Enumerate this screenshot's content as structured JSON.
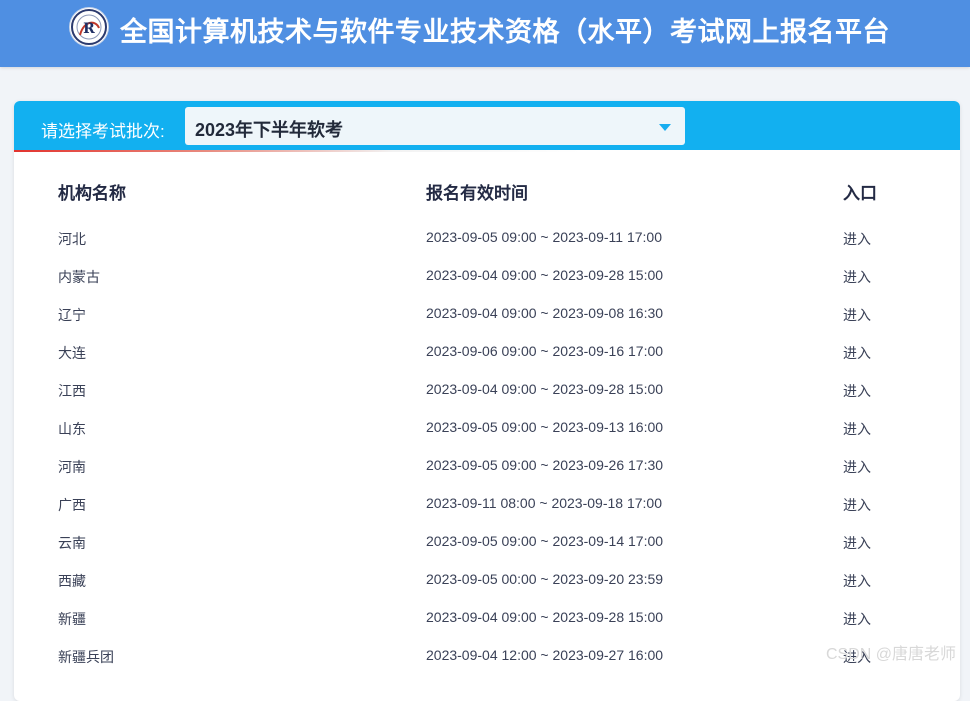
{
  "header": {
    "title": "全国计算机技术与软件专业技术资格（水平）考试网上报名平台",
    "logo_text": "R"
  },
  "selector": {
    "label": "请选择考试批次:",
    "selected": "2023年下半年软考"
  },
  "table": {
    "columns": {
      "org": "机构名称",
      "time": "报名有效时间",
      "entry": "入口"
    },
    "rows": [
      {
        "org": "河北",
        "time": "2023-09-05 09:00 ~ 2023-09-11 17:00",
        "entry": "进入"
      },
      {
        "org": "内蒙古",
        "time": "2023-09-04 09:00 ~ 2023-09-28 15:00",
        "entry": "进入"
      },
      {
        "org": "辽宁",
        "time": "2023-09-04 09:00 ~ 2023-09-08 16:30",
        "entry": "进入"
      },
      {
        "org": "大连",
        "time": "2023-09-06 09:00 ~ 2023-09-16 17:00",
        "entry": "进入"
      },
      {
        "org": "江西",
        "time": "2023-09-04 09:00 ~ 2023-09-28 15:00",
        "entry": "进入"
      },
      {
        "org": "山东",
        "time": "2023-09-05 09:00 ~ 2023-09-13 16:00",
        "entry": "进入"
      },
      {
        "org": "河南",
        "time": "2023-09-05 09:00 ~ 2023-09-26 17:30",
        "entry": "进入"
      },
      {
        "org": "广西",
        "time": "2023-09-11 08:00 ~ 2023-09-18 17:00",
        "entry": "进入"
      },
      {
        "org": "云南",
        "time": "2023-09-05 09:00 ~ 2023-09-14 17:00",
        "entry": "进入"
      },
      {
        "org": "西藏",
        "time": "2023-09-05 00:00 ~ 2023-09-20 23:59",
        "entry": "进入"
      },
      {
        "org": "新疆",
        "time": "2023-09-04 09:00 ~ 2023-09-28 15:00",
        "entry": "进入"
      },
      {
        "org": "新疆兵团",
        "time": "2023-09-04 12:00 ~ 2023-09-27 16:00",
        "entry": "进入"
      }
    ]
  },
  "watermark": "CSDN @唐唐老师",
  "icons": {
    "logo": "exam-logo-icon",
    "dropdown": "caret-down-icon"
  },
  "colors": {
    "header_bg": "#4f8fe2",
    "bar_bg": "#12b0f0",
    "accent_red": "#e2332e",
    "page_bg": "#f1f4f8"
  }
}
